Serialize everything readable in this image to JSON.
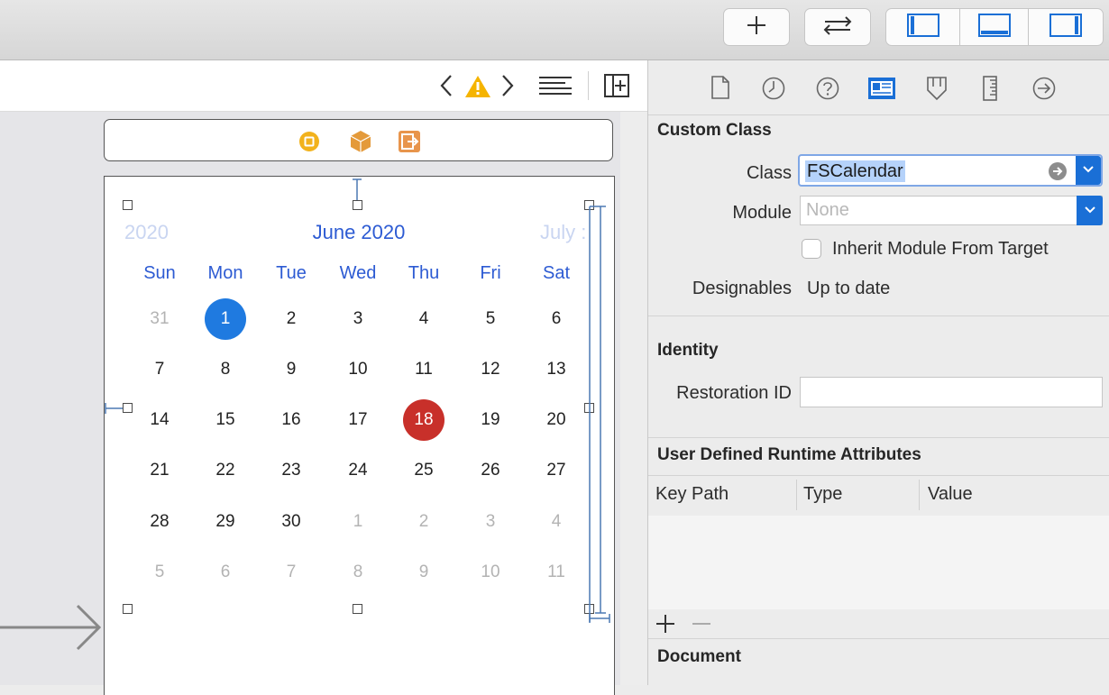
{
  "toolbar": {
    "add_icon": "plus-icon",
    "swap_icon": "arrows-swap-icon",
    "panels": [
      "left-panel-icon",
      "bottom-panel-icon",
      "right-panel-icon"
    ]
  },
  "jumpbar": {
    "icons": [
      "chevron-left-icon",
      "warning-icon",
      "chevron-right-icon",
      "lines-icon",
      "add-editor-icon"
    ],
    "warning_color": "#f5b400"
  },
  "scene_bar": {
    "icons": [
      "view-controller-icon",
      "first-responder-icon",
      "exit-icon"
    ]
  },
  "calendar": {
    "prev_month": "2020",
    "title": "June 2020",
    "next_month": "July :",
    "weekdays": [
      "Sun",
      "Mon",
      "Tue",
      "Wed",
      "Thu",
      "Fri",
      "Sat"
    ],
    "weeks": [
      [
        "31",
        "1",
        "2",
        "3",
        "4",
        "5",
        "6"
      ],
      [
        "7",
        "8",
        "9",
        "10",
        "11",
        "12",
        "13"
      ],
      [
        "14",
        "15",
        "16",
        "17",
        "18",
        "19",
        "20"
      ],
      [
        "21",
        "22",
        "23",
        "24",
        "25",
        "26",
        "27"
      ],
      [
        "28",
        "29",
        "30",
        "1",
        "2",
        "3",
        "4"
      ],
      [
        "5",
        "6",
        "7",
        "8",
        "9",
        "10",
        "11"
      ]
    ],
    "selected_color": "#1f7ae0",
    "today_color": "#c8302a",
    "header_color": "#2d5bd3"
  },
  "inspector": {
    "tabs": [
      "file-icon",
      "history-icon",
      "help-icon",
      "identity-icon",
      "attributes-icon",
      "size-icon",
      "connections-icon"
    ],
    "custom_class": {
      "title": "Custom Class",
      "class_label": "Class",
      "class_value": "FSCalendar",
      "module_label": "Module",
      "module_placeholder": "None",
      "inherit_label": "Inherit Module From Target",
      "designables_label": "Designables",
      "designables_value": "Up to date"
    },
    "identity": {
      "title": "Identity",
      "restoration_label": "Restoration ID",
      "restoration_value": ""
    },
    "runtime": {
      "title": "User Defined Runtime Attributes",
      "columns": [
        "Key Path",
        "Type",
        "Value"
      ]
    },
    "document": {
      "title": "Document"
    }
  }
}
